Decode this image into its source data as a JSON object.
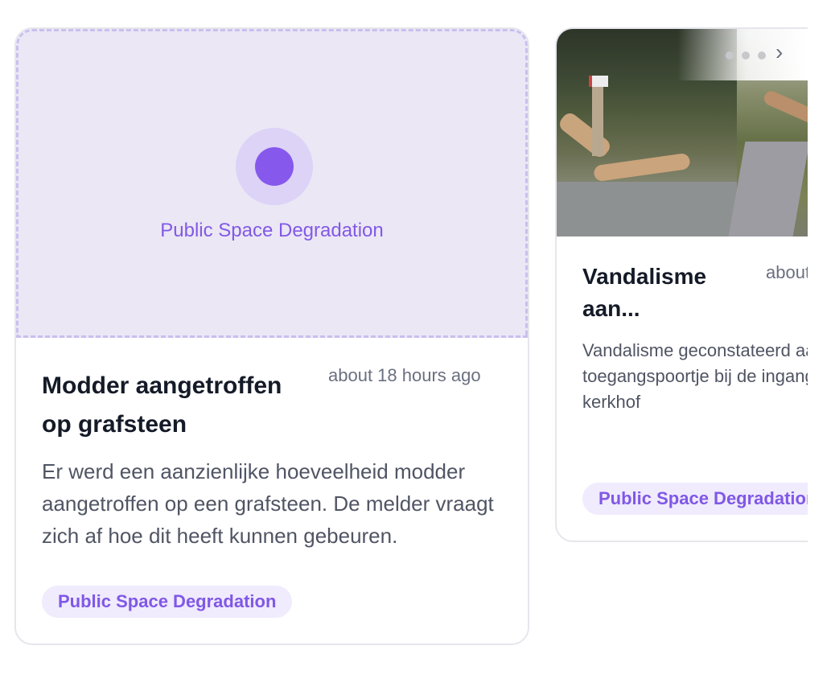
{
  "cards": [
    {
      "placeholder_label": "Public Space Degradation",
      "title": "Modder aangetroffen op grafsteen",
      "time": "about 18 hours ago",
      "description": "Er werd een aanzienlijke hoeveelheid modder aangetroffen op een grafsteen. De melder vraagt zich af hoe dit heeft kunnen gebeuren.",
      "tag": "Public Space Degradation"
    },
    {
      "title": "Vandalisme aan...",
      "time": "about",
      "description": "Vandalisme geconstateerd aan het toegangspoortje bij de ingang van het kerkhof",
      "tag": "Public Space Degradation",
      "carousel": {
        "next_icon": "chevron-right-icon"
      }
    }
  ],
  "colors": {
    "accent": "#8659ec",
    "tag_bg": "#f0ebfd",
    "placeholder_bg": "#ebe7f5"
  }
}
